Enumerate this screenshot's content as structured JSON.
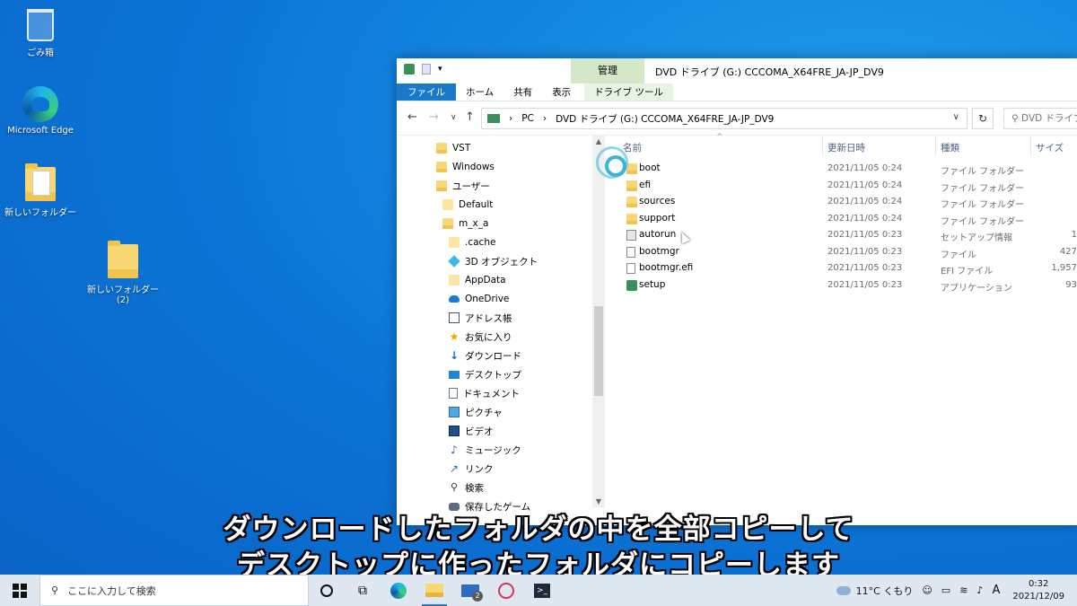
{
  "desktop": {
    "icons": [
      {
        "label": "ごみ箱",
        "icon": "recycle-bin-icon"
      },
      {
        "label": "Microsoft Edge",
        "icon": "edge-icon"
      },
      {
        "label": "新しいフォルダー",
        "icon": "folder-icon"
      },
      {
        "label": "新しいフォルダー (2)",
        "icon": "folder-icon"
      }
    ]
  },
  "window": {
    "title": "DVD ドライブ (G:) CCCOMA_X64FRE_JA-JP_DV9",
    "context_group": "管理",
    "tabs": [
      "ファイル",
      "ホーム",
      "共有",
      "表示",
      "ドライブ ツール"
    ],
    "address": {
      "segments": [
        "PC",
        "DVD ドライブ (G:) CCCOMA_X64FRE_JA-JP_DV9"
      ]
    },
    "search_placeholder": "DVD ドライブ",
    "nav_items": [
      {
        "label": "VST",
        "icon": "folder-icon"
      },
      {
        "label": "Windows",
        "icon": "folder-icon"
      },
      {
        "label": "ユーザー",
        "icon": "folder-icon"
      },
      {
        "label": "Default",
        "icon": "folder-icon"
      },
      {
        "label": "m_x_a",
        "icon": "folder-icon"
      },
      {
        "label": ".cache",
        "icon": "folder-icon"
      },
      {
        "label": "3D オブジェクト",
        "icon": "3d-objects-icon"
      },
      {
        "label": "AppData",
        "icon": "folder-icon"
      },
      {
        "label": "OneDrive",
        "icon": "cloud-icon"
      },
      {
        "label": "アドレス帳",
        "icon": "contacts-icon"
      },
      {
        "label": "お気に入り",
        "icon": "star-icon"
      },
      {
        "label": "ダウンロード",
        "icon": "download-icon"
      },
      {
        "label": "デスクトップ",
        "icon": "desktop-icon"
      },
      {
        "label": "ドキュメント",
        "icon": "document-icon"
      },
      {
        "label": "ピクチャ",
        "icon": "pictures-icon"
      },
      {
        "label": "ビデオ",
        "icon": "video-icon"
      },
      {
        "label": "ミュージック",
        "icon": "music-icon"
      },
      {
        "label": "リンク",
        "icon": "link-icon"
      },
      {
        "label": "検索",
        "icon": "search-icon"
      },
      {
        "label": "保存したゲーム",
        "icon": "games-icon"
      }
    ],
    "columns": {
      "name": "名前",
      "date": "更新日時",
      "type": "種類",
      "size": "サイズ"
    },
    "files": [
      {
        "name": "boot",
        "date": "2021/11/05 0:24",
        "type": "ファイル フォルダー",
        "size": "",
        "icon": "folder-icon"
      },
      {
        "name": "efi",
        "date": "2021/11/05 0:24",
        "type": "ファイル フォルダー",
        "size": "",
        "icon": "folder-icon"
      },
      {
        "name": "sources",
        "date": "2021/11/05 0:24",
        "type": "ファイル フォルダー",
        "size": "",
        "icon": "folder-icon"
      },
      {
        "name": "support",
        "date": "2021/11/05 0:24",
        "type": "ファイル フォルダー",
        "size": "",
        "icon": "folder-icon"
      },
      {
        "name": "autorun",
        "date": "2021/11/05 0:23",
        "type": "セットアップ情報",
        "size": "1",
        "icon": "setup-info-icon"
      },
      {
        "name": "bootmgr",
        "date": "2021/11/05 0:23",
        "type": "ファイル",
        "size": "427",
        "icon": "file-icon"
      },
      {
        "name": "bootmgr.efi",
        "date": "2021/11/05 0:23",
        "type": "EFI ファイル",
        "size": "1,957",
        "icon": "file-icon"
      },
      {
        "name": "setup",
        "date": "2021/11/05 0:23",
        "type": "アプリケーション",
        "size": "93",
        "icon": "setup-app-icon"
      }
    ]
  },
  "subtitles": [
    "ダウンロードしたフォルダの中を全部コピーして",
    "デスクトップに作ったフォルダにコピーします"
  ],
  "taskbar": {
    "search_placeholder": "ここに入力して検索",
    "mail_badge": "2",
    "weather": "11°C くもり",
    "ime": "A",
    "time": "0:32",
    "date": "2021/12/09"
  },
  "colors": {
    "desktop_bg": "#0b74d6",
    "file_tab": "#1979ca",
    "context_group": "#d4e8c8"
  }
}
